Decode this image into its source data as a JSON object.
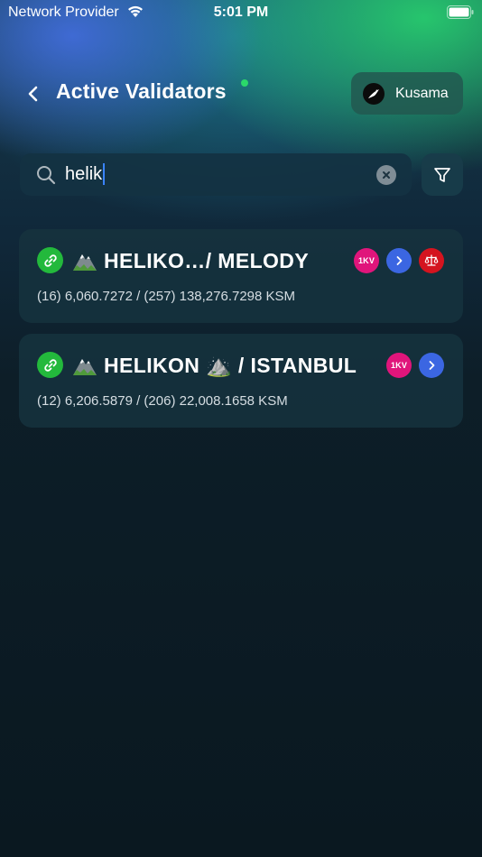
{
  "status_bar": {
    "carrier": "Network Provider",
    "time": "5:01 PM"
  },
  "header": {
    "title": "Active Validators",
    "network_label": "Kusama",
    "online_indicator_color": "#2bd96a"
  },
  "search": {
    "value": "helik",
    "icons": [
      "search-icon",
      "clear-icon",
      "filter-icon"
    ]
  },
  "validators": [
    {
      "name": "HELIKO…/ MELODY",
      "stake": "(16) 6,060.7272 / (257) 138,276.7298 KSM",
      "badges": [
        "1KV",
        "chevron-right",
        "scales"
      ]
    },
    {
      "name": "HELIKON ⛰️ / ISTANBUL",
      "stake": "(12) 6,206.5879 / (206) 22,008.1658 KSM",
      "badges": [
        "1KV",
        "chevron-right"
      ]
    }
  ],
  "colors": {
    "link_badge": "#23b93c",
    "onekv_badge": "#e0157b",
    "next_badge": "#3b66e2",
    "judgement_badge": "#d4141f"
  }
}
